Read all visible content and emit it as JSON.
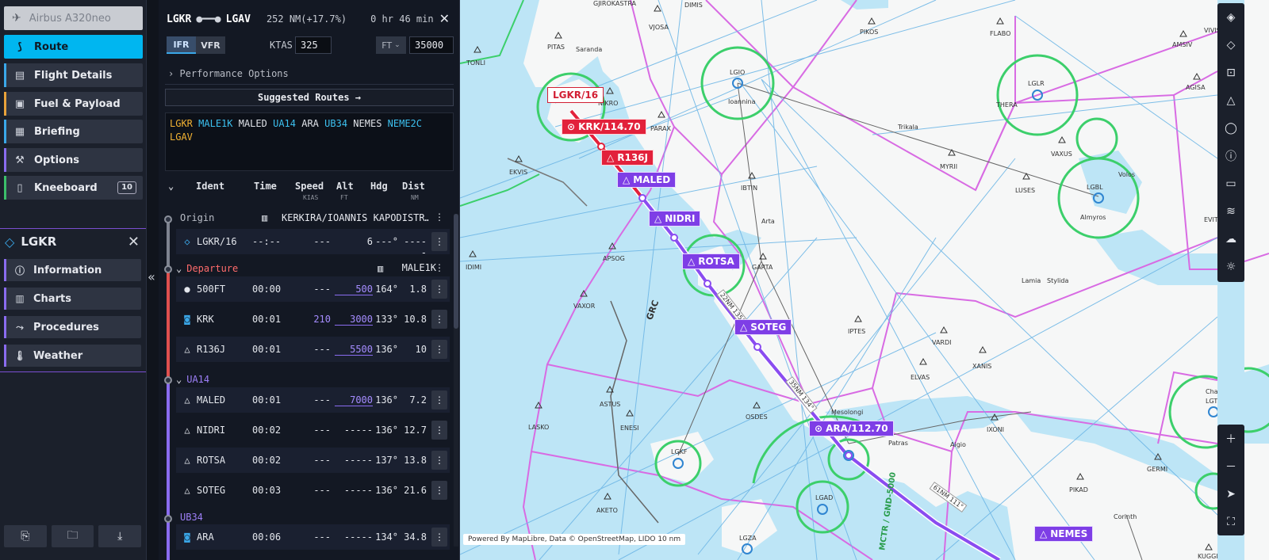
{
  "nav": {
    "aircraft": "Airbus A320neo",
    "items": [
      {
        "label": "Route",
        "icon": "route-icon"
      },
      {
        "label": "Flight Details",
        "icon": "clipboard-icon"
      },
      {
        "label": "Fuel & Payload",
        "icon": "briefcase-icon"
      },
      {
        "label": "Briefing",
        "icon": "document-icon"
      },
      {
        "label": "Options",
        "icon": "wrench-icon"
      },
      {
        "label": "Kneeboard",
        "icon": "notebook-icon",
        "badge": "10"
      }
    ]
  },
  "airport_panel": {
    "ident": "LGKR",
    "items": [
      "Information",
      "Charts",
      "Procedures",
      "Weather"
    ]
  },
  "route": {
    "origin": "LGKR",
    "destination": "LGAV",
    "distance": "252 NM(+17.7%)",
    "duration": "0 hr 46 min",
    "rules": [
      "IFR",
      "VFR"
    ],
    "ktas_label": "KTAS",
    "ktas": "325",
    "alt_unit": "FT",
    "cruise_alt": "35000",
    "perf_options": "Performance Options",
    "suggested": "Suggested Routes →",
    "route_string": [
      {
        "t": "LGKR",
        "c": "y"
      },
      {
        "t": "MALE1K",
        "c": "c"
      },
      {
        "t": "MALED",
        "c": "w"
      },
      {
        "t": "UA14",
        "c": "c"
      },
      {
        "t": "ARA",
        "c": "w"
      },
      {
        "t": "UB34",
        "c": "c"
      },
      {
        "t": "NEMES",
        "c": "w"
      },
      {
        "t": "NEME2C",
        "c": "c"
      },
      {
        "t": "LGAV",
        "c": "y"
      }
    ],
    "columns": {
      "ident": "Ident",
      "time": "Time",
      "speed": "Speed",
      "speed_unit": "KIAS",
      "alt": "Alt",
      "alt_unit": "FT",
      "hdg": "Hdg",
      "dist": "Dist",
      "dist_unit": "NM"
    },
    "origin_row": {
      "label": "Origin",
      "name": "KERKIRA/IOANNIS KAPODISTR…"
    },
    "origin_leg": {
      "ident": "LGKR/16",
      "time": "--:--",
      "speed": "---",
      "alt": "6",
      "hdg": "---°",
      "dist": "-----"
    },
    "departure": {
      "label": "Departure",
      "proc": "MALE1K"
    },
    "dep_legs": [
      {
        "ident": "500FT",
        "time": "00:00",
        "speed": "---",
        "alt": "500",
        "hdg": "164°",
        "dist": "1.8",
        "sym": "●"
      },
      {
        "ident": "KRK",
        "time": "00:01",
        "speed": "210",
        "alt": "3000",
        "hdg": "133°",
        "dist": "10.8",
        "sym": "◙"
      },
      {
        "ident": "R136J",
        "time": "00:01",
        "speed": "---",
        "alt": "5500",
        "hdg": "136°",
        "dist": "10",
        "sym": "△"
      }
    ],
    "airway1": "UA14",
    "airway1_legs": [
      {
        "ident": "MALED",
        "time": "00:01",
        "speed": "---",
        "alt": "7000",
        "hdg": "136°",
        "dist": "7.2",
        "sym": "△"
      },
      {
        "ident": "NIDRI",
        "time": "00:02",
        "speed": "---",
        "alt": "-----",
        "hdg": "136°",
        "dist": "12.7",
        "sym": "△"
      },
      {
        "ident": "ROTSA",
        "time": "00:02",
        "speed": "---",
        "alt": "-----",
        "hdg": "137°",
        "dist": "13.8",
        "sym": "△"
      },
      {
        "ident": "SOTEG",
        "time": "00:03",
        "speed": "---",
        "alt": "-----",
        "hdg": "136°",
        "dist": "21.6",
        "sym": "△"
      }
    ],
    "airway2": "UB34",
    "airway2_legs": [
      {
        "ident": "ARA",
        "time": "00:06",
        "speed": "---",
        "alt": "-----",
        "hdg": "134°",
        "dist": "34.8",
        "sym": "◙"
      }
    ]
  },
  "map": {
    "waypoints": {
      "lgkr16": "LGKR/16",
      "krk": "KRK/114.70",
      "r136j": "R136J",
      "maled": "MALED",
      "nidri": "NIDRI",
      "rotsa": "ROTSA",
      "soteg": "SOTEG",
      "ara": "ARA/112.70",
      "nemes": "NEMES"
    },
    "labels": [
      "GJIROKASTRA",
      "DIMIS",
      "VJOSA",
      "PIKOS",
      "FLABO",
      "AMSIV",
      "VIVIS",
      "PITAS",
      "Saranda",
      "TONLI",
      "NIKRO",
      "LGIO",
      "Ioannina",
      "LGLR",
      "THERA",
      "AGISA",
      "PARAX",
      "Trikala",
      "VAXUS",
      "MYRII",
      "LUSES",
      "LGBL",
      "Volos",
      "Almyros",
      "EKVIS",
      "IBTIN",
      "Arta",
      "APSOG",
      "GARTA",
      "IDIMI",
      "VAXOR",
      "Lamia",
      "Stylida",
      "IPTES",
      "VARDI",
      "XANIS",
      "ELVAS",
      "ASTUS",
      "ENESI",
      "OSDES",
      "Mesolongi",
      "Patras",
      "Aigio",
      "IXONI",
      "LASKO",
      "LGKF",
      "LGAD",
      "AKETO",
      "LGZA",
      "GERMI",
      "PIKAD",
      "Corinth",
      "KUGGI",
      "EVIT",
      "Chalkida",
      "LGTG",
      "GRC",
      "22NM 135°",
      "35NM 134°",
      "61NM 111°",
      "MCTR / GND-5000"
    ],
    "attribution": "Powered By  MapLibre, Data ©  OpenStreetMap,  LIDO  10 nm"
  }
}
